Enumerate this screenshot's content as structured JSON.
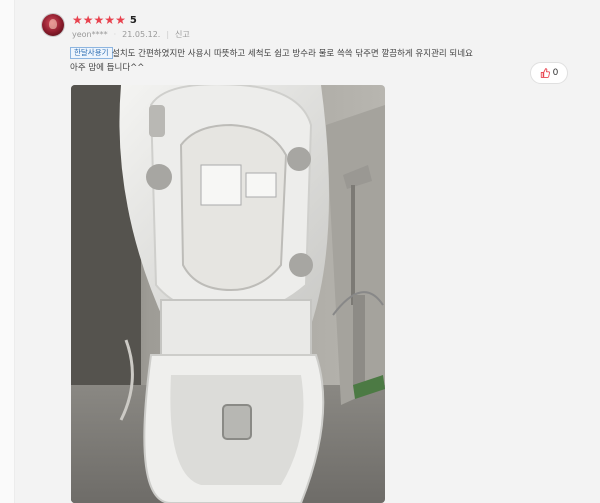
{
  "review": {
    "rating_stars": 5,
    "score": "5",
    "username": "yeon****",
    "date": "21.05.12.",
    "report_label": "신고",
    "badge": "한달사용기",
    "text": "설치도 간편하였지만 사용시 따뜻하고 세척도 쉽고 방수라 물로 쓱쓱 닦주면 깔끔하게 유지관리 되네요\n아주 맘에 듭니다^^",
    "like_count": "0"
  },
  "colors": {
    "star": "#e8424e",
    "badge_text": "#2f6fb3",
    "badge_border": "#8db5e0"
  },
  "icons": {
    "avatar": "user-avatar",
    "like": "thumbs-up-icon",
    "star": "star-icon"
  }
}
